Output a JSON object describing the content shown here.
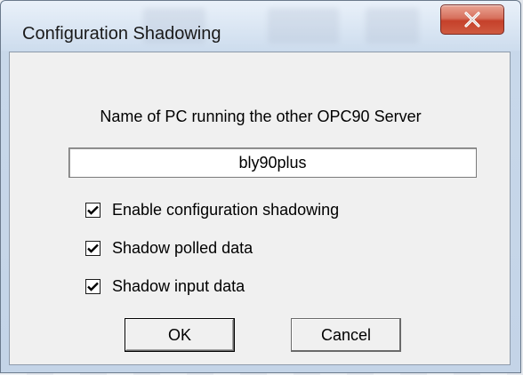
{
  "window": {
    "title": "Configuration Shadowing",
    "close_icon": "close-x-icon"
  },
  "dialog": {
    "prompt": "Name of PC running the other OPC90 Server",
    "pc_name_value": "bly90plus",
    "checkboxes": [
      {
        "label": "Enable configuration shadowing",
        "checked": true
      },
      {
        "label": "Shadow polled data",
        "checked": true
      },
      {
        "label": "Shadow input data",
        "checked": true
      }
    ],
    "ok_label": "OK",
    "cancel_label": "Cancel"
  },
  "colors": {
    "close_button": "#c5402a",
    "client_background": "#f0f0f0",
    "frame": "#c8d8ea"
  }
}
